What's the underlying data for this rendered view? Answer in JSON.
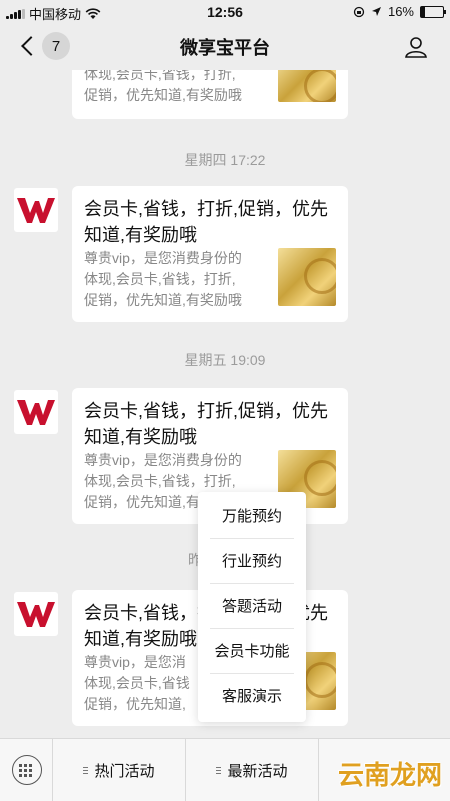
{
  "status": {
    "carrier": "中国移动",
    "time": "12:56",
    "battery": "16%",
    "battery_level": 0.16
  },
  "nav": {
    "back_count": "7",
    "title": "微享宝平台"
  },
  "timestamps": [
    "星期四 17:22",
    "星期五 19:09",
    "昨"
  ],
  "card_partial": {
    "desc_lines": [
      "体现,会员卡,省钱，打折,",
      "促销，优先知道,有奖励哦"
    ]
  },
  "cards": [
    {
      "title": "会员卡,省钱，打折,促销，优先知道,有奖励哦",
      "desc_lines": [
        "尊贵vip，是您消费身份的",
        "体现,会员卡,省钱，打折,",
        "促销，优先知道,有奖励哦"
      ]
    },
    {
      "title": "会员卡,省钱，打折,促销，优先知道,有奖励哦",
      "desc_lines": [
        "尊贵vip，是您消费身份的",
        "体现,会员卡,省钱，打折,",
        "促销，优先知道,有奖励哦"
      ]
    },
    {
      "title": "会员卡,省钱，打折,促销，优先知道,有奖励哦",
      "desc_lines": [
        "尊贵vip，是您消",
        "体现,会员卡,省钱",
        "促销，优先知道,"
      ]
    }
  ],
  "popup_menu": [
    "万能预约",
    "行业预约",
    "答题活动",
    "会员卡功能",
    "客服演示"
  ],
  "tabbar": {
    "tabs": [
      "热门活动",
      "最新活动"
    ]
  },
  "watermark": "云南龙网",
  "colors": {
    "brand_red": "#c8102e",
    "gold": "#c9a23b"
  }
}
